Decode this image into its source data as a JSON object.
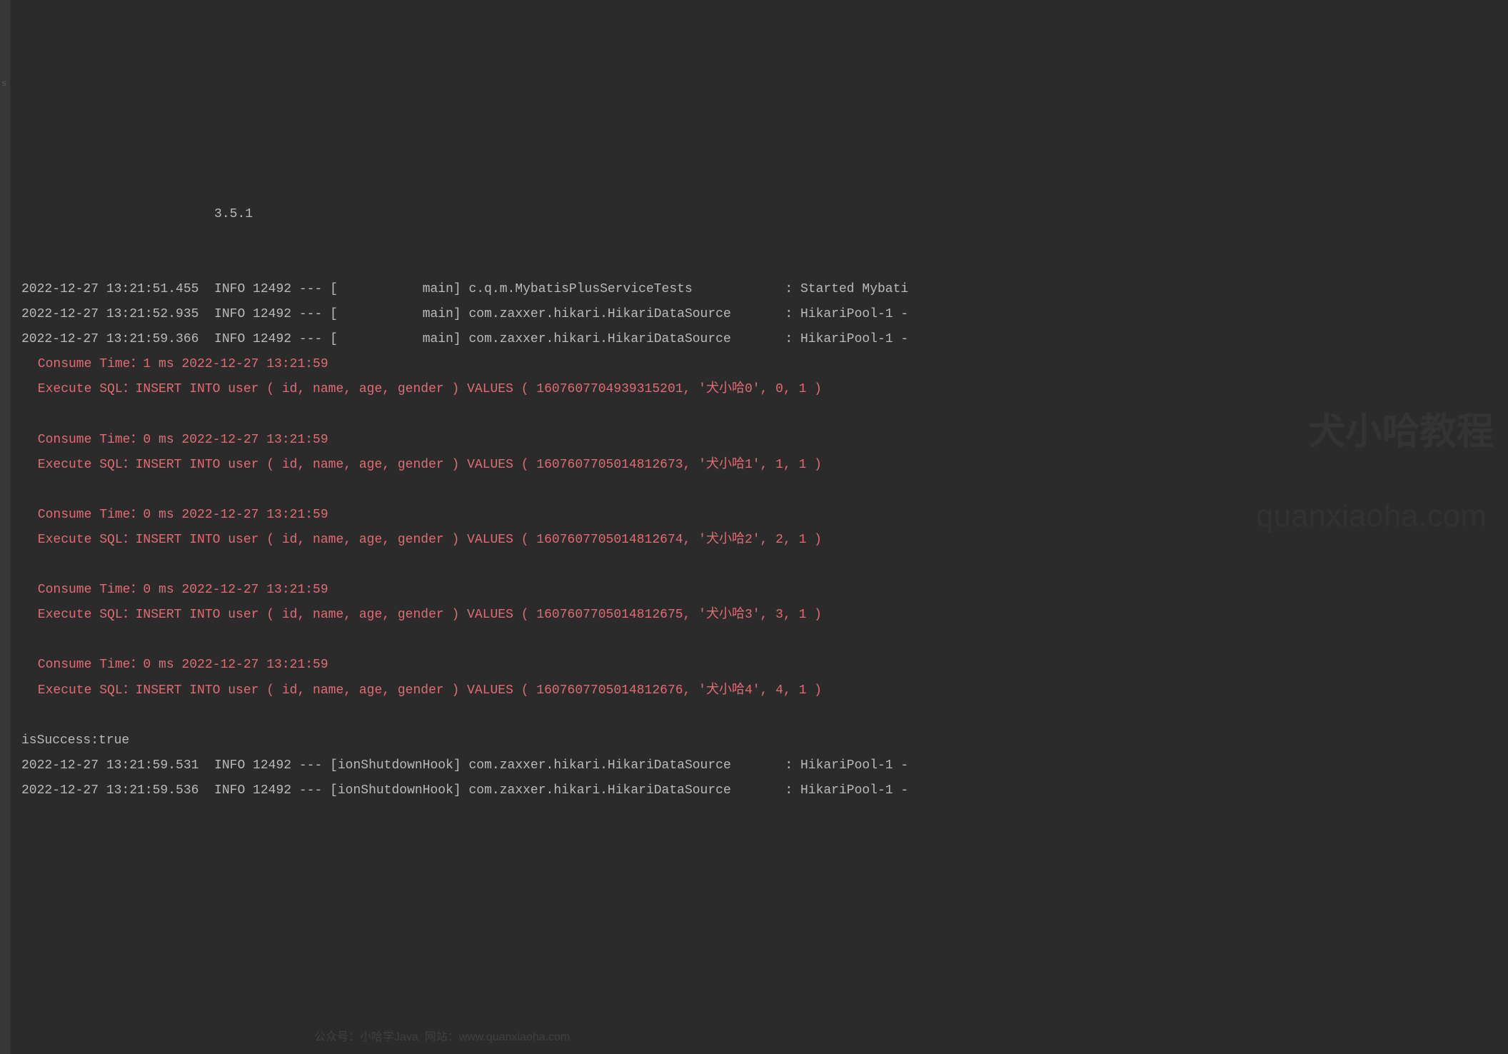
{
  "gutter": {
    "letter": "s"
  },
  "version": "                         3.5.1 ",
  "logLines": [
    {
      "type": "info",
      "text": "2022-12-27 13:21:51.455  INFO 12492 --- [           main] c.q.m.MybatisPlusServiceTests            : Started Mybati"
    },
    {
      "type": "info",
      "text": "2022-12-27 13:21:52.935  INFO 12492 --- [           main] com.zaxxer.hikari.HikariDataSource       : HikariPool-1 -"
    },
    {
      "type": "info",
      "text": "2022-12-27 13:21:59.366  INFO 12492 --- [           main] com.zaxxer.hikari.HikariDataSource       : HikariPool-1 -"
    },
    {
      "type": "sql",
      "text": " Consume Time：1 ms 2022-12-27 13:21:59"
    },
    {
      "type": "sql",
      "text": " Execute SQL：INSERT INTO user ( id, name, age, gender ) VALUES ( 1607607704939315201, '犬小哈0', 0, 1 )"
    },
    {
      "type": "blank",
      "text": ""
    },
    {
      "type": "sql",
      "text": " Consume Time：0 ms 2022-12-27 13:21:59"
    },
    {
      "type": "sql",
      "text": " Execute SQL：INSERT INTO user ( id, name, age, gender ) VALUES ( 1607607705014812673, '犬小哈1', 1, 1 )"
    },
    {
      "type": "blank",
      "text": ""
    },
    {
      "type": "sql",
      "text": " Consume Time：0 ms 2022-12-27 13:21:59"
    },
    {
      "type": "sql",
      "text": " Execute SQL：INSERT INTO user ( id, name, age, gender ) VALUES ( 1607607705014812674, '犬小哈2', 2, 1 )"
    },
    {
      "type": "blank",
      "text": ""
    },
    {
      "type": "sql",
      "text": " Consume Time：0 ms 2022-12-27 13:21:59"
    },
    {
      "type": "sql",
      "text": " Execute SQL：INSERT INTO user ( id, name, age, gender ) VALUES ( 1607607705014812675, '犬小哈3', 3, 1 )"
    },
    {
      "type": "blank",
      "text": ""
    },
    {
      "type": "sql",
      "text": " Consume Time：0 ms 2022-12-27 13:21:59"
    },
    {
      "type": "sql",
      "text": " Execute SQL：INSERT INTO user ( id, name, age, gender ) VALUES ( 1607607705014812676, '犬小哈4', 4, 1 )"
    },
    {
      "type": "blank",
      "text": ""
    },
    {
      "type": "success",
      "text": "isSuccess:true"
    },
    {
      "type": "info",
      "text": "2022-12-27 13:21:59.531  INFO 12492 --- [ionShutdownHook] com.zaxxer.hikari.HikariDataSource       : HikariPool-1 -"
    },
    {
      "type": "info",
      "text": "2022-12-27 13:21:59.536  INFO 12492 --- [ionShutdownHook] com.zaxxer.hikari.HikariDataSource       : HikariPool-1 -"
    }
  ],
  "watermarks": {
    "brand": "犬小哈教程",
    "url": "quanxiaoha.com",
    "footer": "公众号：小哈学Java  网站：www.quanxiaoha.com"
  }
}
